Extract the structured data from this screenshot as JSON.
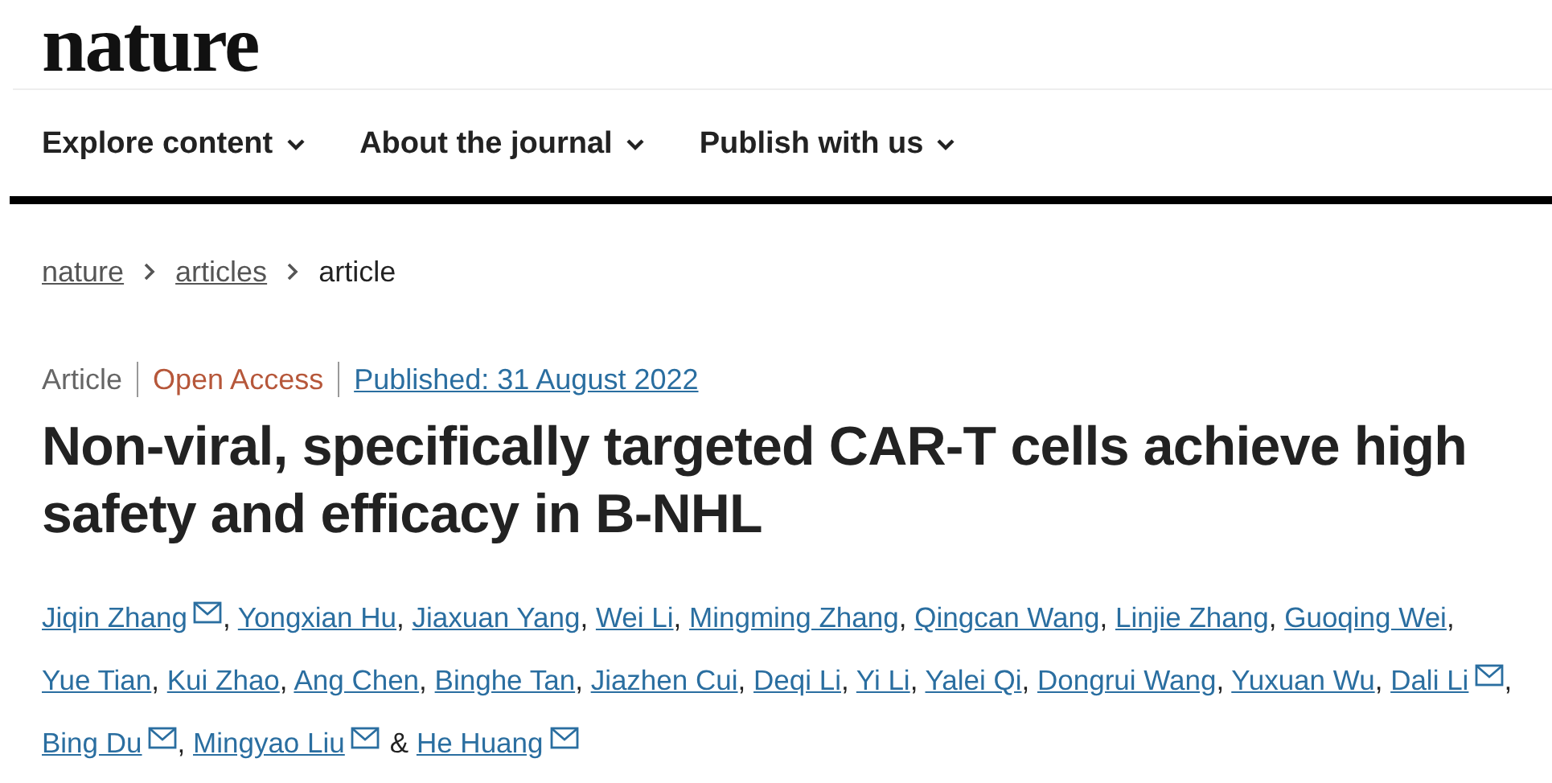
{
  "logo": "nature",
  "nav": [
    {
      "label": "Explore content"
    },
    {
      "label": "About the journal"
    },
    {
      "label": "Publish with us"
    }
  ],
  "breadcrumb": [
    {
      "label": "nature",
      "kind": "link"
    },
    {
      "label": "articles",
      "kind": "link"
    },
    {
      "label": "article",
      "kind": "current"
    }
  ],
  "meta": [
    {
      "text": "Article",
      "kind": "type"
    },
    {
      "text": "Open Access",
      "kind": "access"
    },
    {
      "text": "Published: 31 August 2022",
      "kind": "date"
    }
  ],
  "title": "Non-viral, specifically targeted CAR-T cells achieve high safety and efficacy in B-NHL",
  "authors": [
    {
      "name": "Jiqin Zhang",
      "email": true,
      "after": ","
    },
    {
      "name": "Yongxian Hu",
      "email": false,
      "after": ","
    },
    {
      "name": "Jiaxuan Yang",
      "email": false,
      "after": ","
    },
    {
      "name": "Wei Li",
      "email": false,
      "after": ","
    },
    {
      "name": "Mingming Zhang",
      "email": false,
      "after": ","
    },
    {
      "name": "Qingcan Wang",
      "email": false,
      "after": ","
    },
    {
      "name": "Linjie Zhang",
      "email": false,
      "after": ","
    },
    {
      "name": "Guoqing Wei",
      "email": false,
      "after": ","
    },
    {
      "name": "Yue Tian",
      "email": false,
      "after": ","
    },
    {
      "name": "Kui Zhao",
      "email": false,
      "after": ","
    },
    {
      "name": "Ang Chen",
      "email": false,
      "after": ","
    },
    {
      "name": "Binghe Tan",
      "email": false,
      "after": ","
    },
    {
      "name": "Jiazhen Cui",
      "email": false,
      "after": ","
    },
    {
      "name": "Deqi Li",
      "email": false,
      "after": ","
    },
    {
      "name": "Yi Li",
      "email": false,
      "after": ","
    },
    {
      "name": "Yalei Qi",
      "email": false,
      "after": ","
    },
    {
      "name": "Dongrui Wang",
      "email": false,
      "after": ","
    },
    {
      "name": "Yuxuan Wu",
      "email": false,
      "after": ","
    },
    {
      "name": "Dali Li",
      "email": true,
      "after": ","
    },
    {
      "name": "Bing Du",
      "email": true,
      "after": ","
    },
    {
      "name": "Mingyao Liu",
      "email": true,
      "after": "&"
    },
    {
      "name": "He Huang",
      "email": true
    }
  ]
}
